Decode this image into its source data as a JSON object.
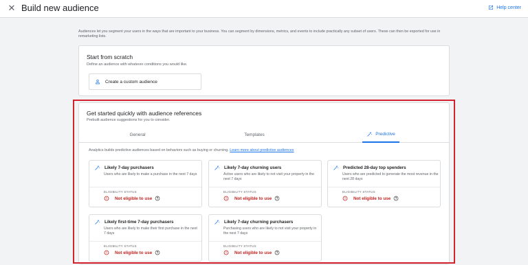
{
  "header": {
    "close_icon": "close-icon",
    "title": "Build new audience",
    "help_label": "Help center",
    "help_icon": "open-in-new-icon"
  },
  "intro": "Audiences let you segment your users in the ways that are important to your business. You can segment by dimensions, metrics, and events to include practically any subset of users. These can then be exported for use in remarketing lists.",
  "scratch": {
    "title": "Start from scratch",
    "subtitle": "Define an audience with whatever conditions you would like.",
    "button_label": "Create a custom audience",
    "button_icon": "person-icon"
  },
  "references": {
    "title": "Get started quickly with audience references",
    "subtitle": "Prebuilt audience suggestions for you to consider.",
    "tabs": [
      {
        "label": "General"
      },
      {
        "label": "Templates"
      },
      {
        "label": "Predictive",
        "active": true,
        "icon": "magic-wand-icon"
      }
    ],
    "description": "Analytics builds predictive audiences based on behaviors such as buying or churning.",
    "learn_more": "Learn more about predictive audiences",
    "eligibility_label": "ELIGIBILITY STATUS",
    "eligibility_value": "Not eligible to use",
    "cards": [
      {
        "title": "Likely 7-day purchasers",
        "desc": "Users who are likely to make a purchase in the next 7 days"
      },
      {
        "title": "Likely 7-day churning users",
        "desc": "Active users who are likely to not visit your property in the next 7 days"
      },
      {
        "title": "Predicted 28-day top spenders",
        "desc": "Users who are predicted to generate the most revenue in the next 28 days"
      },
      {
        "title": "Likely first-time 7-day purchasers",
        "desc": "Users who are likely to make their first purchase in the next 7 days"
      },
      {
        "title": "Likely 7-day churning purchasers",
        "desc": "Purchasing users who are likely to not visit your property in the next 7 days"
      }
    ]
  },
  "colors": {
    "accent": "#1a73e8",
    "error": "#c5221f",
    "highlight": "#d5202e"
  }
}
